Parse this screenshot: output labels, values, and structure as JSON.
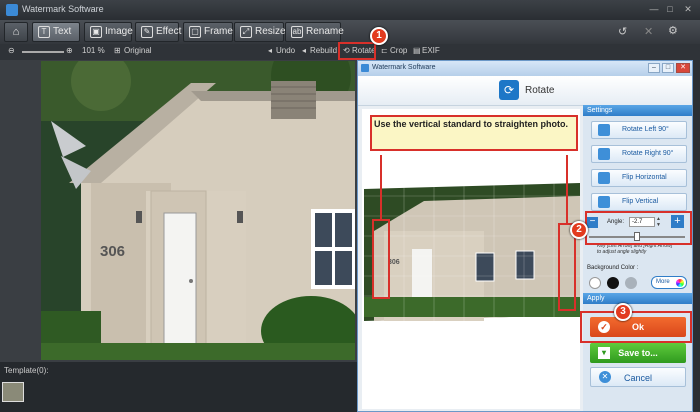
{
  "app": {
    "title": "Watermark Software"
  },
  "tabs": [
    {
      "label": "Text"
    },
    {
      "label": "Image"
    },
    {
      "label": "Effect"
    },
    {
      "label": "Frame"
    },
    {
      "label": "Resize"
    },
    {
      "label": "Rename"
    }
  ],
  "toolbar": {
    "zoom": "101 %",
    "original": "Original",
    "undo": "Undo",
    "rebuild": "Rebuild",
    "rotate": "Rotate",
    "crop": "Crop",
    "exif": "EXIF"
  },
  "photo": {
    "house_number": "306"
  },
  "template_bar": {
    "label": "Template(0):"
  },
  "dialog": {
    "title": "Watermark Software",
    "header": "Rotate",
    "callout": "Use the vertical standard to straighten photo.",
    "preview_number": "306",
    "settings_label": "Settings",
    "buttons": {
      "rotate_left": "Rotate Left 90°",
      "rotate_right": "Rotate Right 90°",
      "flip_h": "Flip Horizontal",
      "flip_v": "Flip Vertical"
    },
    "angle_label": "Angle:",
    "angle_value": "-2.7",
    "hint": "Key [Left Arrow] and [Right Arrow] to adjust angle slightly",
    "bg_label": "Background Color :",
    "more": "More",
    "apply_label": "Apply",
    "ok": "Ok",
    "save": "Save to...",
    "cancel": "Cancel"
  },
  "callouts": [
    "1",
    "2",
    "3"
  ]
}
